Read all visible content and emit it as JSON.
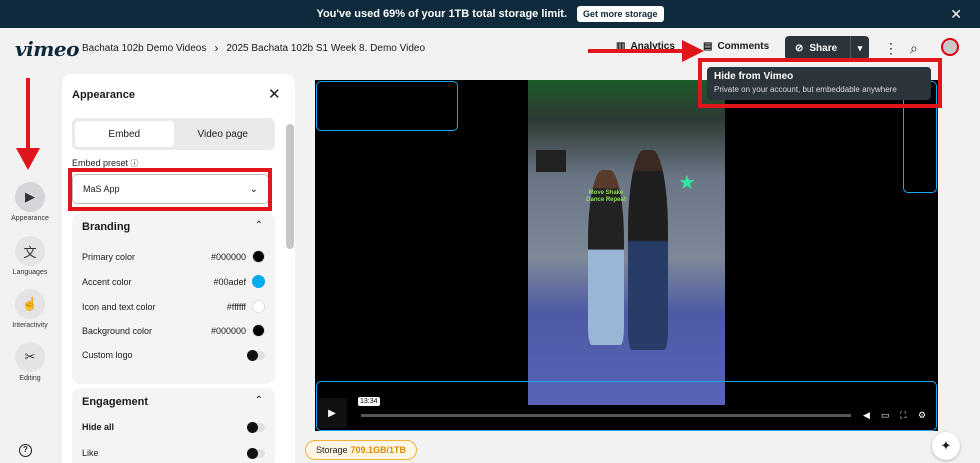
{
  "banner": {
    "message": "You've used 69% of your 1TB total storage limit.",
    "button": "Get more storage",
    "close": "✕"
  },
  "header": {
    "logo": "vimeo",
    "breadcrumb": [
      "Bachata 102b Demo Videos",
      "2025 Bachata 102b S1 Week 8. Demo Video"
    ],
    "analytics": "Analytics",
    "comments": "Comments",
    "share": "Share"
  },
  "tooltip": {
    "title": "Hide from Vimeo",
    "subtitle": "Private on your account, but embeddable anywhere"
  },
  "rail": [
    {
      "label": "Appearance",
      "icon": "play-square-icon"
    },
    {
      "label": "Languages",
      "icon": "translate-icon"
    },
    {
      "label": "Interactivity",
      "icon": "pointer-click-icon"
    },
    {
      "label": "Editing",
      "icon": "scissors-icon"
    }
  ],
  "panel": {
    "title": "Appearance",
    "tabs": [
      "Embed",
      "Video page"
    ],
    "preset_label": "Embed preset",
    "preset_value": "MaS App",
    "branding": {
      "title": "Branding",
      "rows": [
        {
          "label": "Primary color",
          "value": "#000000",
          "color": "#000000"
        },
        {
          "label": "Accent color",
          "value": "#00adef",
          "color": "#00adef"
        },
        {
          "label": "Icon and text color",
          "value": "#ffffff",
          "color": "#ffffff"
        },
        {
          "label": "Background color",
          "value": "#000000",
          "color": "#000000"
        }
      ],
      "custom_logo": "Custom logo"
    },
    "engagement": {
      "title": "Engagement",
      "hide_all": "Hide all",
      "like": "Like"
    }
  },
  "video": {
    "timecode": "13:34",
    "shirt_text": "Move Shake Dance Repeat"
  },
  "storage": {
    "label": "Storage",
    "value": "709.1GB/1TB"
  },
  "colors": {
    "annotation": "#e0161b",
    "accent": "#00adef",
    "banner": "#0e2a3b"
  }
}
